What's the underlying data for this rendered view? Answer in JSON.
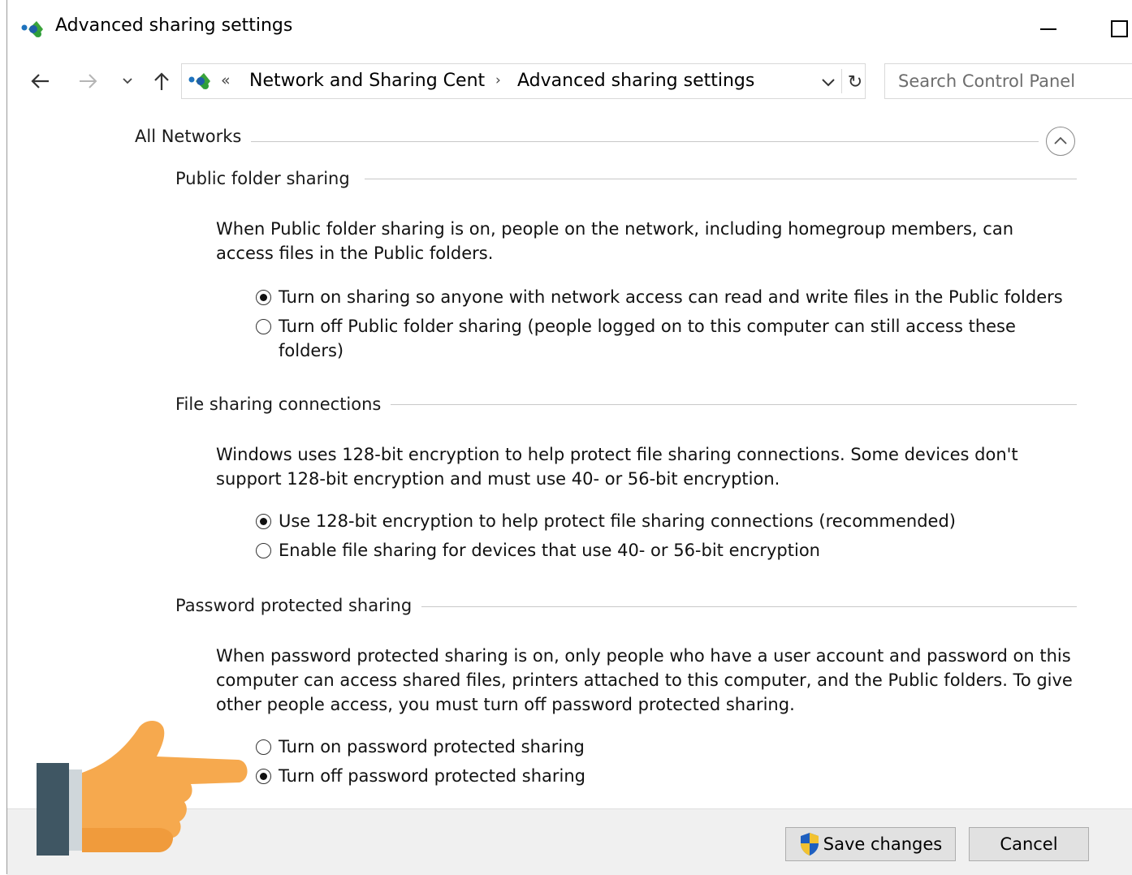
{
  "window": {
    "title": "Advanced sharing settings",
    "controls": [
      "minimize",
      "maximize"
    ]
  },
  "nav": {
    "icons": [
      "back-arrow-icon",
      "forward-arrow-icon",
      "recent-chevron-icon",
      "up-arrow-icon"
    ],
    "address": {
      "chevrons": "«",
      "crumbs": [
        "Network and Sharing Cent",
        "Advanced sharing settings"
      ],
      "separator": "›",
      "refresh": "↻"
    },
    "search": {
      "placeholder": "Search Control Panel",
      "value": ""
    }
  },
  "content": {
    "group_title": "All Networks",
    "sections": [
      {
        "title": "Public folder sharing",
        "description": "When Public folder sharing is on, people on the network, including homegroup members, can access files in the Public folders.",
        "options": [
          {
            "label": "Turn on sharing so anyone with network access can read and write files in the Public folders",
            "checked": true
          },
          {
            "label": "Turn off Public folder sharing (people logged on to this computer can still access these folders)",
            "checked": false
          }
        ]
      },
      {
        "title": "File sharing connections",
        "description": "Windows uses 128-bit encryption to help protect file sharing connections. Some devices don't support 128-bit encryption and must use 40- or 56-bit encryption.",
        "options": [
          {
            "label": "Use 128-bit encryption to help protect file sharing connections (recommended)",
            "checked": true
          },
          {
            "label": "Enable file sharing for devices that use 40- or 56-bit encryption",
            "checked": false
          }
        ]
      },
      {
        "title": "Password protected sharing",
        "description": "When password protected sharing is on, only people who have a user account and password on this computer can access shared files, printers attached to this computer, and the Public folders. To give other people access, you must turn off password protected sharing.",
        "options": [
          {
            "label": "Turn on password protected sharing",
            "checked": false
          },
          {
            "label": "Turn off password protected sharing",
            "checked": true
          }
        ]
      }
    ]
  },
  "footer": {
    "save_label": "Save changes",
    "cancel_label": "Cancel"
  },
  "colors": {
    "accent_green": "#3aa33a",
    "accent_blue": "#1e73be",
    "footer_bg": "#f0f0f0",
    "hand_orange": "#f6a94e",
    "cuff_dark": "#3f5663"
  }
}
